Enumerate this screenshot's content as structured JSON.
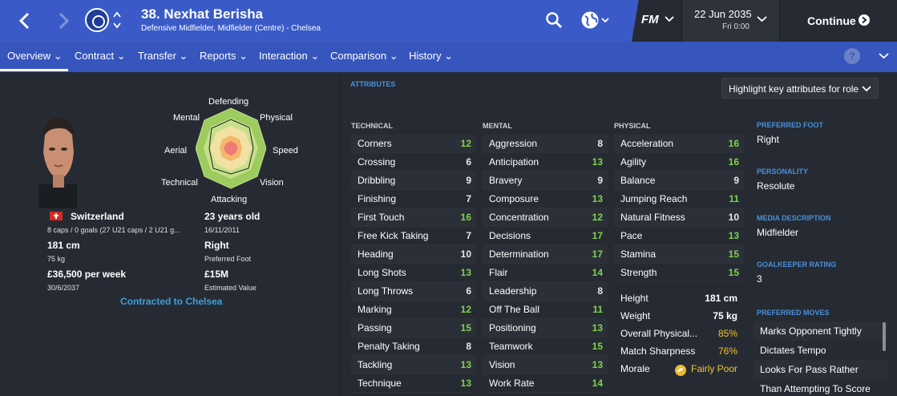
{
  "header": {
    "title": "38. Nexhat Berisha",
    "subtitle": "Defensive Midfielder, Midfielder (Centre) - Chelsea",
    "brand": "FM",
    "date": "22 Jun 2035",
    "time": "Fri 0:00",
    "continue_label": "Continue"
  },
  "tabs": [
    "Overview",
    "Contract",
    "Transfer",
    "Reports",
    "Interaction",
    "Comparison",
    "History"
  ],
  "help_label": "?",
  "radar_labels": {
    "defending": "Defending",
    "physical": "Physical",
    "speed": "Speed",
    "vision": "Vision",
    "attacking": "Attacking",
    "technical": "Technical",
    "aerial": "Aerial",
    "mental": "Mental"
  },
  "profile": {
    "nationality": "Switzerland",
    "caps": "8 caps / 0 goals (27 U21 caps / 2 U21 g...",
    "height": "181 cm",
    "weight": "75 kg",
    "wage": "£36,500 per week",
    "contract_expiry": "30/6/2037",
    "age": "23 years old",
    "dob": "16/11/2011",
    "preferred_foot": "Right",
    "preferred_foot_label": "Preferred Foot",
    "value": "£15M",
    "value_label": "Estimated Value",
    "contract_link": "Contracted to Chelsea"
  },
  "attributes": {
    "heading": "ATTRIBUTES",
    "highlight_button": "Highlight key attributes for role",
    "technical_heading": "TECHNICAL",
    "mental_heading": "MENTAL",
    "physical_heading": "PHYSICAL",
    "technical": [
      {
        "name": "Corners",
        "value": "12"
      },
      {
        "name": "Crossing",
        "value": "6"
      },
      {
        "name": "Dribbling",
        "value": "9"
      },
      {
        "name": "Finishing",
        "value": "7"
      },
      {
        "name": "First Touch",
        "value": "16"
      },
      {
        "name": "Free Kick Taking",
        "value": "7"
      },
      {
        "name": "Heading",
        "value": "10"
      },
      {
        "name": "Long Shots",
        "value": "13"
      },
      {
        "name": "Long Throws",
        "value": "6"
      },
      {
        "name": "Marking",
        "value": "12"
      },
      {
        "name": "Passing",
        "value": "15"
      },
      {
        "name": "Penalty Taking",
        "value": "8"
      },
      {
        "name": "Tackling",
        "value": "13"
      },
      {
        "name": "Technique",
        "value": "13"
      }
    ],
    "mental": [
      {
        "name": "Aggression",
        "value": "8"
      },
      {
        "name": "Anticipation",
        "value": "13"
      },
      {
        "name": "Bravery",
        "value": "9"
      },
      {
        "name": "Composure",
        "value": "13"
      },
      {
        "name": "Concentration",
        "value": "12"
      },
      {
        "name": "Decisions",
        "value": "17"
      },
      {
        "name": "Determination",
        "value": "17"
      },
      {
        "name": "Flair",
        "value": "14"
      },
      {
        "name": "Leadership",
        "value": "8"
      },
      {
        "name": "Off The Ball",
        "value": "11"
      },
      {
        "name": "Positioning",
        "value": "13"
      },
      {
        "name": "Teamwork",
        "value": "15"
      },
      {
        "name": "Vision",
        "value": "13"
      },
      {
        "name": "Work Rate",
        "value": "14"
      }
    ],
    "physical": [
      {
        "name": "Acceleration",
        "value": "16"
      },
      {
        "name": "Agility",
        "value": "16"
      },
      {
        "name": "Balance",
        "value": "9"
      },
      {
        "name": "Jumping Reach",
        "value": "11"
      },
      {
        "name": "Natural Fitness",
        "value": "10"
      },
      {
        "name": "Pace",
        "value": "13"
      },
      {
        "name": "Stamina",
        "value": "15"
      },
      {
        "name": "Strength",
        "value": "15"
      }
    ],
    "physical_extra": {
      "height_label": "Height",
      "height": "181 cm",
      "weight_label": "Weight",
      "weight": "75 kg",
      "overall_label": "Overall Physical...",
      "overall": "85%",
      "sharpness_label": "Match Sharpness",
      "sharpness": "76%",
      "morale_label": "Morale",
      "morale": "Fairly Poor"
    },
    "colors": {
      "high": "#7dd34a",
      "normal": "#e8e8e8",
      "warning": "#f0c030"
    }
  },
  "side": {
    "preferred_foot_heading": "PREFERRED FOOT",
    "preferred_foot": "Right",
    "personality_heading": "PERSONALITY",
    "personality": "Resolute",
    "media_heading": "MEDIA DESCRIPTION",
    "media": "Midfielder",
    "gk_heading": "GOALKEEPER RATING",
    "gk": "3",
    "moves_heading": "PREFERRED MOVES",
    "moves": [
      "Marks Opponent Tightly",
      "Dictates Tempo",
      "Looks For Pass Rather",
      "Than Attempting To Score"
    ]
  }
}
